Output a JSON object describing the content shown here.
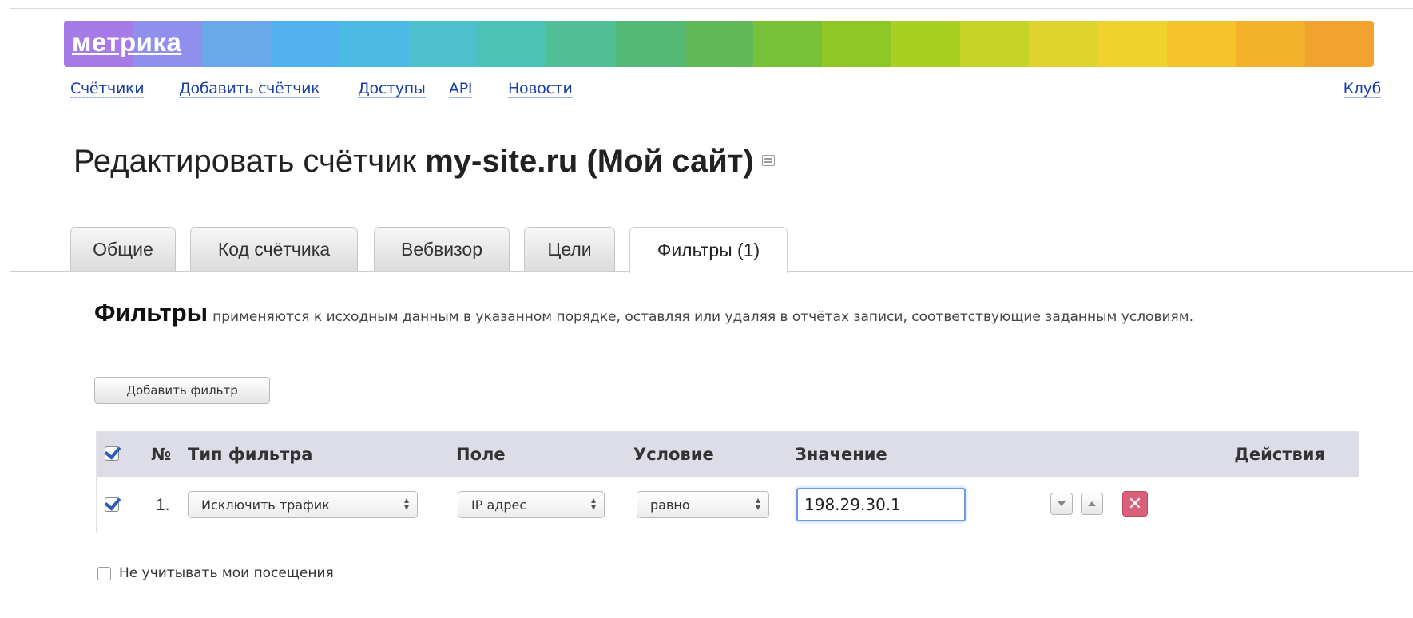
{
  "logo": "метрика",
  "colors": {
    "rainbow": [
      "#a77be6",
      "#8f8fee",
      "#6aa8ec",
      "#52b2ee",
      "#4bbbe6",
      "#4cc0cc",
      "#4cc2b5",
      "#52be96",
      "#55b978",
      "#61b95a",
      "#78c23a",
      "#8fc824",
      "#a9cf22",
      "#c6d428",
      "#dfd42c",
      "#f0d22c",
      "#f5c42a",
      "#f4b12c",
      "#f2a22e"
    ],
    "link": "#1a3fa8",
    "delete": "#d9607a"
  },
  "nav": {
    "items": [
      "Счётчики",
      "Добавить счётчик",
      "Доступы",
      "API",
      "Новости"
    ],
    "right": "Клуб"
  },
  "title": {
    "prefix": "Редактировать счётчик",
    "bold": "my-site.ru (Мой сайт)"
  },
  "tabs": [
    {
      "label": "Общие"
    },
    {
      "label": "Код счётчика"
    },
    {
      "label": "Вебвизор"
    },
    {
      "label": "Цели"
    },
    {
      "label": "Фильтры (1)",
      "active": true
    }
  ],
  "filters": {
    "heading": "Фильтры",
    "description": "применяются к исходным данным в указанном порядке, оставляя или удаляя в отчётах записи, соответствующие заданным условиям.",
    "add_button": "Добавить фильтр",
    "columns": {
      "num": "№",
      "type": "Тип фильтра",
      "field": "Поле",
      "condition": "Условие",
      "value": "Значение",
      "actions": "Действия"
    },
    "rows": [
      {
        "checked": true,
        "num": "1.",
        "type": "Исключить трафик",
        "field": "IP адрес",
        "condition": "равно",
        "value": "198.29.30.1"
      }
    ],
    "delete_symbol": "✕"
  },
  "ignore_visits": {
    "label": "Не учитывать мои посещения",
    "checked": false
  }
}
